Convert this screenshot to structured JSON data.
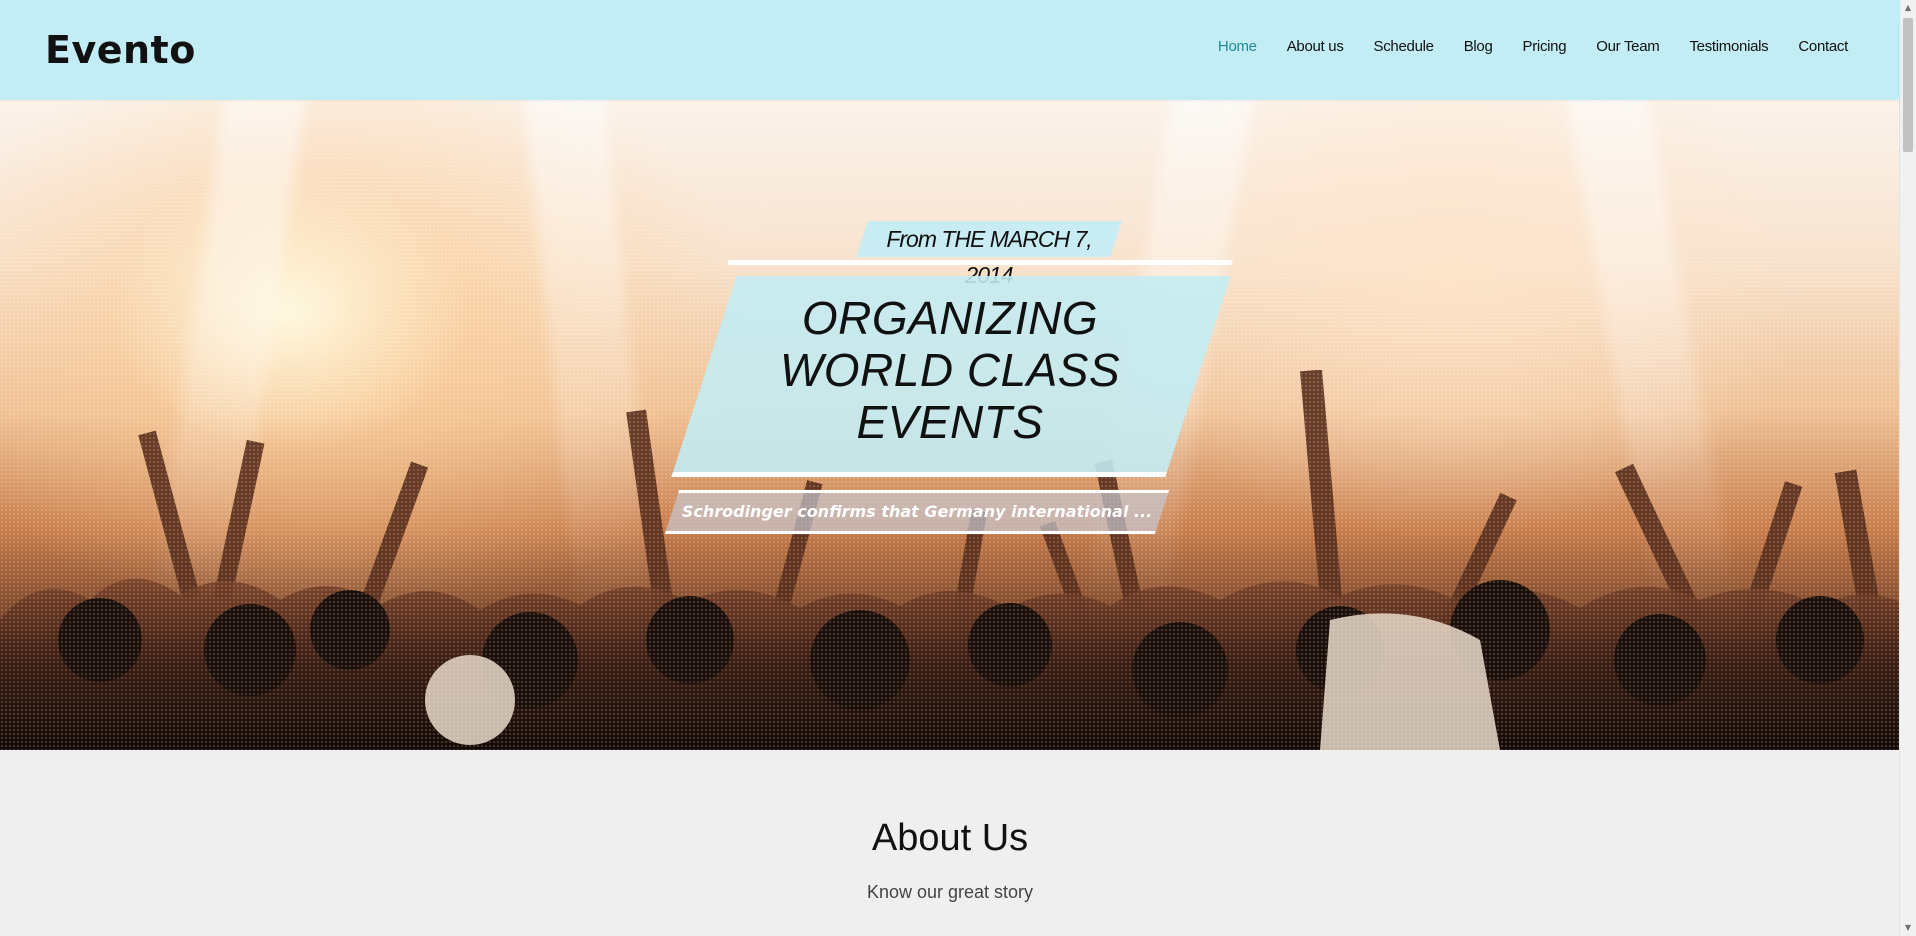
{
  "header": {
    "logo": "Evento",
    "nav": [
      {
        "label": "Home",
        "active": true
      },
      {
        "label": "About us",
        "active": false
      },
      {
        "label": "Schedule",
        "active": false
      },
      {
        "label": "Blog",
        "active": false
      },
      {
        "label": "Pricing",
        "active": false
      },
      {
        "label": "Our Team",
        "active": false
      },
      {
        "label": "Testimonials",
        "active": false
      },
      {
        "label": "Contact",
        "active": false
      }
    ]
  },
  "hero": {
    "date": "From THE MARCH 7, 2014",
    "title_lines": [
      "ORGANIZING",
      "WORLD CLASS",
      "EVENTS"
    ],
    "subtitle": "Schrodinger confirms that Germany international ..."
  },
  "about": {
    "title": "About Us",
    "subtitle": "Know our great story"
  },
  "colors": {
    "header_bg": "#c3edf5",
    "nav_active": "#1f8c94",
    "page_bg": "#efefef"
  }
}
